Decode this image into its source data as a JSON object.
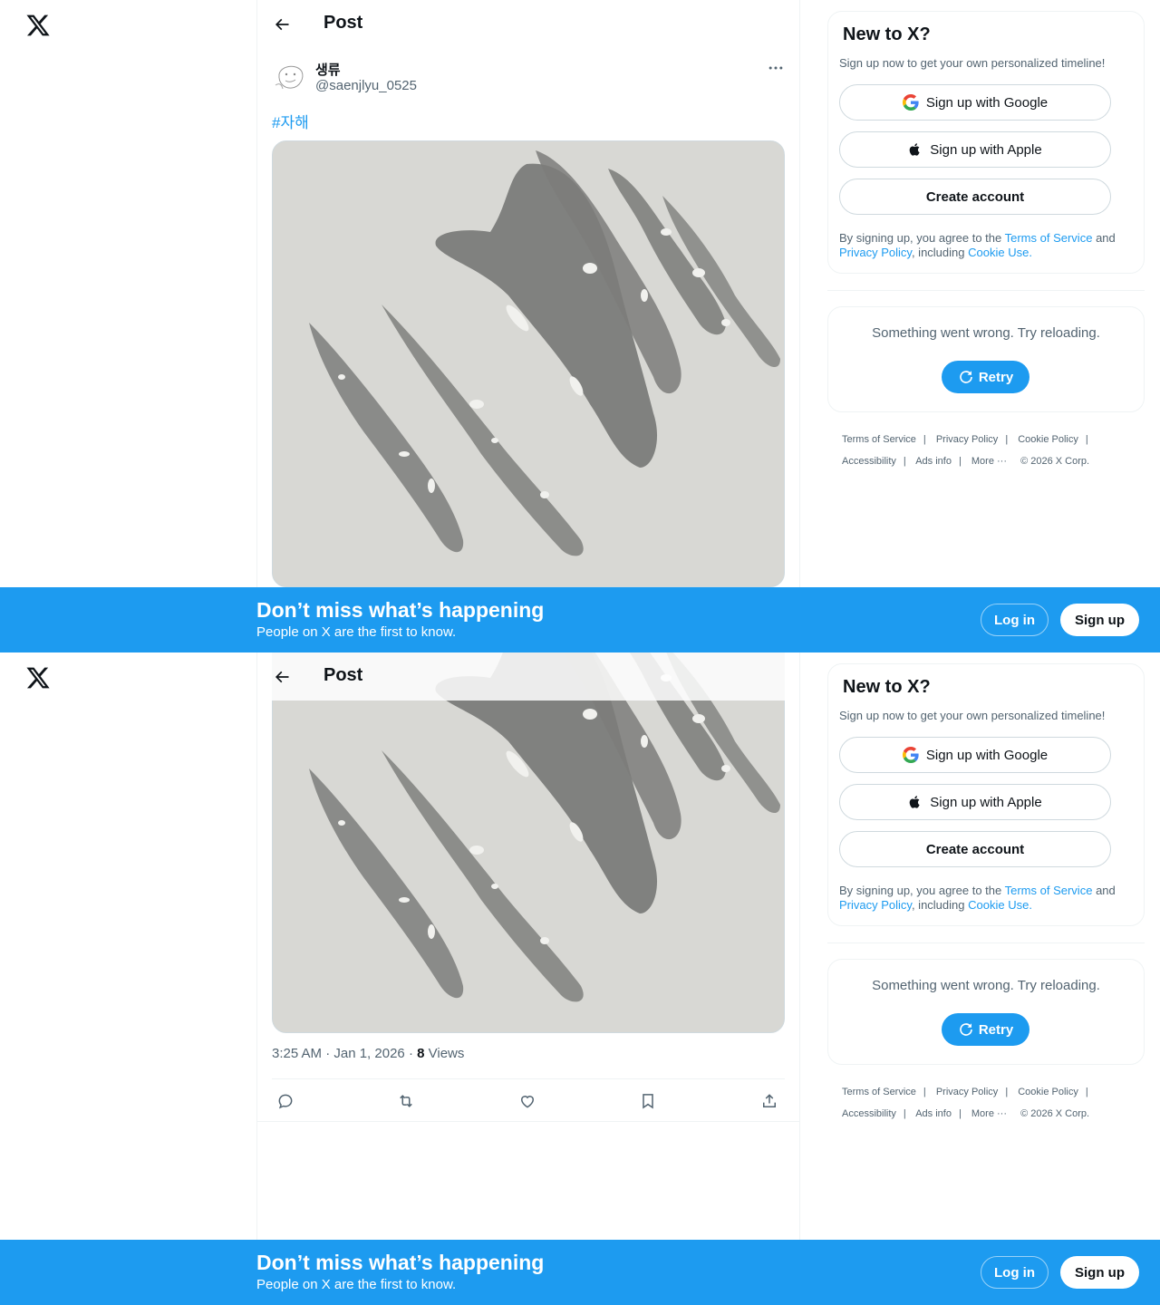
{
  "header": {
    "back_label": "back",
    "title": "Post"
  },
  "author": {
    "name": "생류",
    "handle": "@saenjlyu_0525"
  },
  "tweet": {
    "hashtag": "#자해",
    "time": "3:25 AM · Jan 1, 2026",
    "separator": "·",
    "views_count": "8",
    "views_label": "Views"
  },
  "actions": [
    "reply-icon",
    "repost-icon",
    "like-icon",
    "bookmark-icon",
    "share-icon"
  ],
  "signup_card": {
    "title": "New to X?",
    "subtitle": "Sign up now to get your own personalized timeline!",
    "google_label": "Sign up with Google",
    "apple_label": "Sign up with Apple",
    "create_label": "Create account",
    "terms_prefix": "By signing up, you agree to the",
    "terms_link": "Terms of Service",
    "terms_and": "and",
    "privacy_link": "Privacy Policy",
    "terms_including": ", including",
    "cookie_link": "Cookie Use."
  },
  "error_card": {
    "message": "Something went wrong. Try reloading.",
    "retry_label": "Retry"
  },
  "footer": {
    "links_row1": [
      "Terms of Service",
      "Privacy Policy",
      "Cookie Policy"
    ],
    "links_row2": [
      "Accessibility",
      "Ads info",
      "More ···"
    ],
    "copyright": "© 2026 X Corp."
  },
  "banner": {
    "title": "Don’t miss what’s happening",
    "subtitle": "People on X are the first to know.",
    "login_label": "Log in",
    "signup_label": "Sign up"
  },
  "colors": {
    "brand": "#1d9bf0",
    "text": "#0f1419",
    "secondary": "#536471",
    "border": "#eff3f4"
  }
}
